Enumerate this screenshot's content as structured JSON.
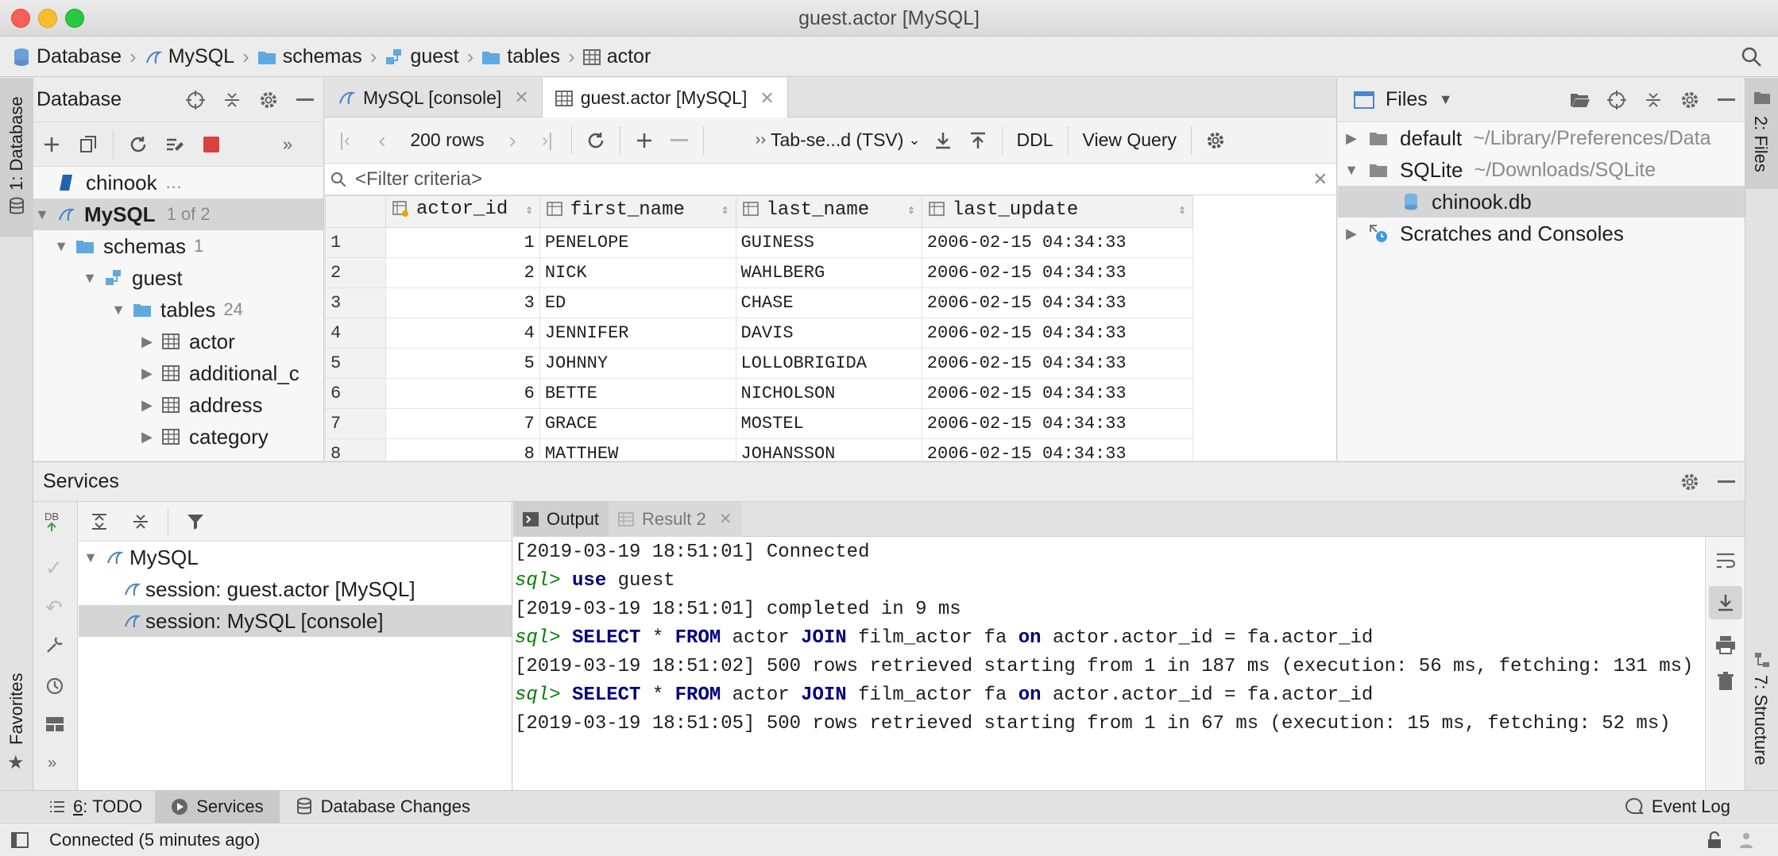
{
  "window": {
    "title": "guest.actor [MySQL]"
  },
  "breadcrumb": [
    "Database",
    "MySQL",
    "schemas",
    "guest",
    "tables",
    "actor"
  ],
  "left_strip": {
    "database_tab": "1: Database",
    "favorites_tab": "Favorites"
  },
  "right_strip": {
    "files_tab": "2: Files",
    "structure_tab": "7: Structure"
  },
  "db_panel": {
    "title": "Database",
    "tree": [
      {
        "label": "chinook",
        "note": "…"
      },
      {
        "label": "MySQL",
        "note": "1 of 2"
      },
      {
        "label": "schemas",
        "note": "1"
      },
      {
        "label": "guest",
        "note": ""
      },
      {
        "label": "tables",
        "note": "24"
      },
      {
        "label": "actor",
        "note": ""
      },
      {
        "label": "additional_c",
        "note": ""
      },
      {
        "label": "address",
        "note": ""
      },
      {
        "label": "category",
        "note": ""
      }
    ]
  },
  "editor": {
    "tabs": [
      {
        "label": "MySQL [console]",
        "active": false
      },
      {
        "label": "guest.actor [MySQL]",
        "active": true
      }
    ],
    "toolbar": {
      "rows": "200 rows",
      "format": "Tab-se...d (TSV)",
      "ddl": "DDL",
      "view_query": "View Query"
    },
    "filter_placeholder": "<Filter criteria>",
    "columns": [
      "actor_id",
      "first_name",
      "last_name",
      "last_update"
    ],
    "rows": [
      [
        "1",
        "1",
        "PENELOPE",
        "GUINESS",
        "2006-02-15 04:34:33"
      ],
      [
        "2",
        "2",
        "NICK",
        "WAHLBERG",
        "2006-02-15 04:34:33"
      ],
      [
        "3",
        "3",
        "ED",
        "CHASE",
        "2006-02-15 04:34:33"
      ],
      [
        "4",
        "4",
        "JENNIFER",
        "DAVIS",
        "2006-02-15 04:34:33"
      ],
      [
        "5",
        "5",
        "JOHNNY",
        "LOLLOBRIGIDA",
        "2006-02-15 04:34:33"
      ],
      [
        "6",
        "6",
        "BETTE",
        "NICHOLSON",
        "2006-02-15 04:34:33"
      ],
      [
        "7",
        "7",
        "GRACE",
        "MOSTEL",
        "2006-02-15 04:34:33"
      ],
      [
        "8",
        "8",
        "MATTHEW",
        "JOHANSSON",
        "2006-02-15 04:34:33"
      ]
    ]
  },
  "files_panel": {
    "title": "Files",
    "tree": [
      {
        "label": "default",
        "path": "~/Library/Preferences/Data"
      },
      {
        "label": "SQLite",
        "path": "~/Downloads/SQLite"
      },
      {
        "label": "chinook.db",
        "path": ""
      },
      {
        "label": "Scratches and Consoles",
        "path": ""
      }
    ]
  },
  "services": {
    "title": "Services",
    "tree": [
      {
        "label": "MySQL"
      },
      {
        "label": "session: guest.actor [MySQL]"
      },
      {
        "label": "session: MySQL [console]"
      }
    ],
    "output_tabs": [
      {
        "label": "Output",
        "active": true
      },
      {
        "label": "Result 2",
        "active": false
      }
    ],
    "console": [
      {
        "type": "log",
        "text": "[2019-03-19 18:51:01] Connected"
      },
      {
        "type": "sql",
        "prompt": "sql>",
        "text": "use guest"
      },
      {
        "type": "log",
        "text": "[2019-03-19 18:51:01] completed in 9 ms"
      },
      {
        "type": "sql",
        "prompt": "sql>",
        "text": "SELECT * FROM actor JOIN film_actor fa on actor.actor_id = fa.actor_id"
      },
      {
        "type": "log",
        "text": "[2019-03-19 18:51:02] 500 rows retrieved starting from 1 in 187 ms (execution: 56 ms, fetching: 131 ms)"
      },
      {
        "type": "sql",
        "prompt": "sql>",
        "text": "SELECT * FROM actor JOIN film_actor fa on actor.actor_id = fa.actor_id"
      },
      {
        "type": "log",
        "text": "[2019-03-19 18:51:05] 500 rows retrieved starting from 1 in 67 ms (execution: 15 ms, fetching: 52 ms)"
      }
    ],
    "sql_keywords": [
      "SELECT",
      "FROM",
      "JOIN",
      "on",
      "use"
    ]
  },
  "toolwindow_bar": {
    "todo_num": "6",
    "todo": ": TODO",
    "services": "Services",
    "db_changes": "Database Changes",
    "event_log": "Event Log"
  },
  "status": {
    "text": "Connected (5 minutes ago)"
  },
  "icons": [
    "search-icon",
    "crosshair-icon",
    "collapse-icon",
    "gear-icon",
    "minimize-icon",
    "add-icon",
    "copy-icon",
    "refresh-icon",
    "properties-icon",
    "stop-icon",
    "table-icon",
    "folder-icon",
    "schema-icon",
    "database-file-icon",
    "mysql-icon"
  ],
  "colors": {
    "accent": "#3d8fd6",
    "stop": "#d94040",
    "keyword": "#000080",
    "prompt": "#008000",
    "selection": "#d5d5d5"
  }
}
